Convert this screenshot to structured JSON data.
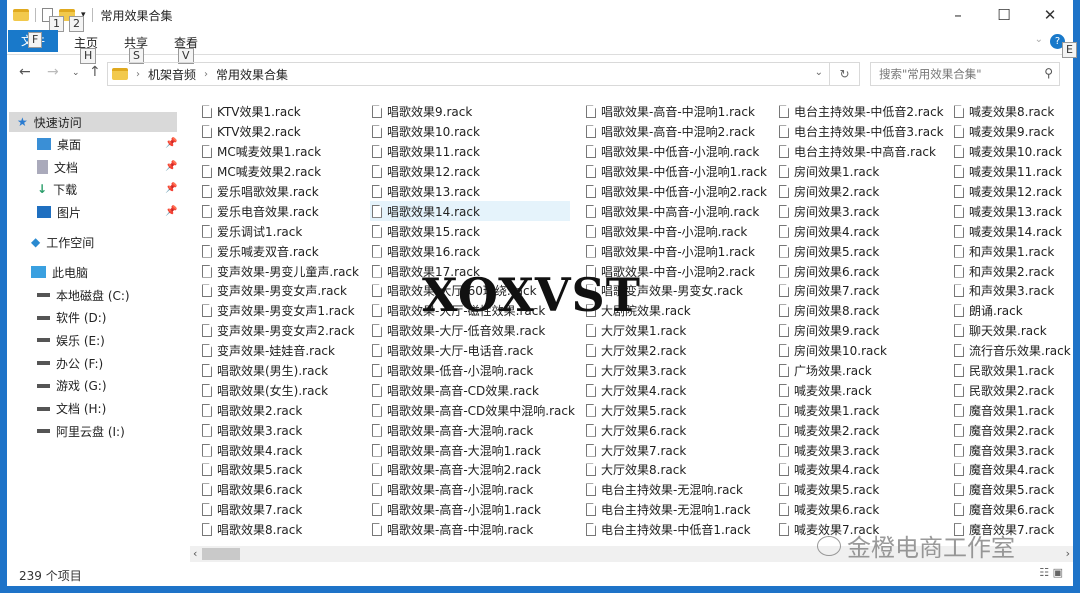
{
  "window": {
    "title": "常用效果合集",
    "minimize": "–",
    "maximize": "☐",
    "close": "✕"
  },
  "quick_access_keytips": [
    "1",
    "2"
  ],
  "ribbon": {
    "file": "文件",
    "file_keytip": "F",
    "tabs": [
      {
        "label": "主页",
        "keytip": "H"
      },
      {
        "label": "共享",
        "keytip": "S"
      },
      {
        "label": "查看",
        "keytip": "V"
      }
    ],
    "help_keytip": "E"
  },
  "address": {
    "crumbs": [
      "机架音频",
      "常用效果合集"
    ]
  },
  "search": {
    "placeholder": "搜索\"常用效果合集\""
  },
  "sidebar": {
    "quick_access": "快速访问",
    "pinned": [
      "桌面",
      "文档",
      "下载",
      "图片"
    ],
    "workspace": "工作空间",
    "this_pc": "此电脑",
    "drives": [
      "本地磁盘 (C:)",
      "软件 (D:)",
      "娱乐 (E:)",
      "办公 (F:)",
      "游戏 (G:)",
      "文档 (H:)",
      "阿里云盘 (I:)"
    ]
  },
  "files": {
    "selected": "唱歌效果14.rack",
    "columns": [
      [
        "KTV效果1.rack",
        "KTV效果2.rack",
        "MC喊麦效果1.rack",
        "MC喊麦效果2.rack",
        "爱乐唱歌效果.rack",
        "爱乐电音效果.rack",
        "爱乐调试1.rack",
        "爱乐喊麦双音.rack",
        "变声效果-男变儿童声.rack",
        "变声效果-男变女声.rack",
        "变声效果-男变女声1.rack",
        "变声效果-男变女声2.rack",
        "变声效果-娃娃音.rack",
        "唱歌效果(男生).rack",
        "唱歌效果(女生).rack",
        "唱歌效果2.rack",
        "唱歌效果3.rack",
        "唱歌效果4.rack",
        "唱歌效果5.rack",
        "唱歌效果6.rack",
        "唱歌效果7.rack",
        "唱歌效果8.rack"
      ],
      [
        "唱歌效果9.rack",
        "唱歌效果10.rack",
        "唱歌效果11.rack",
        "唱歌效果12.rack",
        "唱歌效果13.rack",
        "唱歌效果14.rack",
        "唱歌效果15.rack",
        "唱歌效果16.rack",
        "唱歌效果17.rack",
        "唱歌效果-大厅-60环绕.rack",
        "唱歌效果-大厅-磁性效果.rack",
        "唱歌效果-大厅-低音效果.rack",
        "唱歌效果-大厅-电话音.rack",
        "唱歌效果-低音-小混响.rack",
        "唱歌效果-高音-CD效果.rack",
        "唱歌效果-高音-CD效果中混响.rack",
        "唱歌效果-高音-大混响.rack",
        "唱歌效果-高音-大混响1.rack",
        "唱歌效果-高音-大混响2.rack",
        "唱歌效果-高音-小混响.rack",
        "唱歌效果-高音-小混响1.rack",
        "唱歌效果-高音-中混响.rack"
      ],
      [
        "唱歌效果-高音-中混响1.rack",
        "唱歌效果-高音-中混响2.rack",
        "唱歌效果-中低音-小混响.rack",
        "唱歌效果-中低音-小混响1.rack",
        "唱歌效果-中低音-小混响2.rack",
        "唱歌效果-中高音-小混响.rack",
        "唱歌效果-中音-小混响.rack",
        "唱歌效果-中音-小混响1.rack",
        "唱歌效果-中音-小混响2.rack",
        "唱歌变声效果-男变女.rack",
        "大剧院效果.rack",
        "大厅效果1.rack",
        "大厅效果2.rack",
        "大厅效果3.rack",
        "大厅效果4.rack",
        "大厅效果5.rack",
        "大厅效果6.rack",
        "大厅效果7.rack",
        "大厅效果8.rack",
        "电台主持效果-无混响.rack",
        "电台主持效果-无混响1.rack",
        "电台主持效果-中低音1.rack"
      ],
      [
        "电台主持效果-中低音2.rack",
        "电台主持效果-中低音3.rack",
        "电台主持效果-中高音.rack",
        "房间效果1.rack",
        "房间效果2.rack",
        "房间效果3.rack",
        "房间效果4.rack",
        "房间效果5.rack",
        "房间效果6.rack",
        "房间效果7.rack",
        "房间效果8.rack",
        "房间效果9.rack",
        "房间效果10.rack",
        "广场效果.rack",
        "喊麦效果.rack",
        "喊麦效果1.rack",
        "喊麦效果2.rack",
        "喊麦效果3.rack",
        "喊麦效果4.rack",
        "喊麦效果5.rack",
        "喊麦效果6.rack",
        "喊麦效果7.rack"
      ],
      [
        "喊麦效果8.rack",
        "喊麦效果9.rack",
        "喊麦效果10.rack",
        "喊麦效果11.rack",
        "喊麦效果12.rack",
        "喊麦效果13.rack",
        "喊麦效果14.rack",
        "和声效果1.rack",
        "和声效果2.rack",
        "和声效果3.rack",
        "朗诵.rack",
        "聊天效果.rack",
        "流行音乐效果.rack",
        "民歌效果1.rack",
        "民歌效果2.rack",
        "魔音效果1.rack",
        "魔音效果2.rack",
        "魔音效果3.rack",
        "魔音效果4.rack",
        "魔音效果5.rack",
        "魔音效果6.rack",
        "魔音效果7.rack"
      ]
    ]
  },
  "status": {
    "item_count": "239 个项目"
  },
  "watermarks": {
    "overlay": "XOXVST",
    "brand": "金橙电商工作室"
  },
  "colors": {
    "accent": "#1979ca",
    "selection": "#e5f3fb",
    "sidebar_selected": "#d9d9d9"
  }
}
